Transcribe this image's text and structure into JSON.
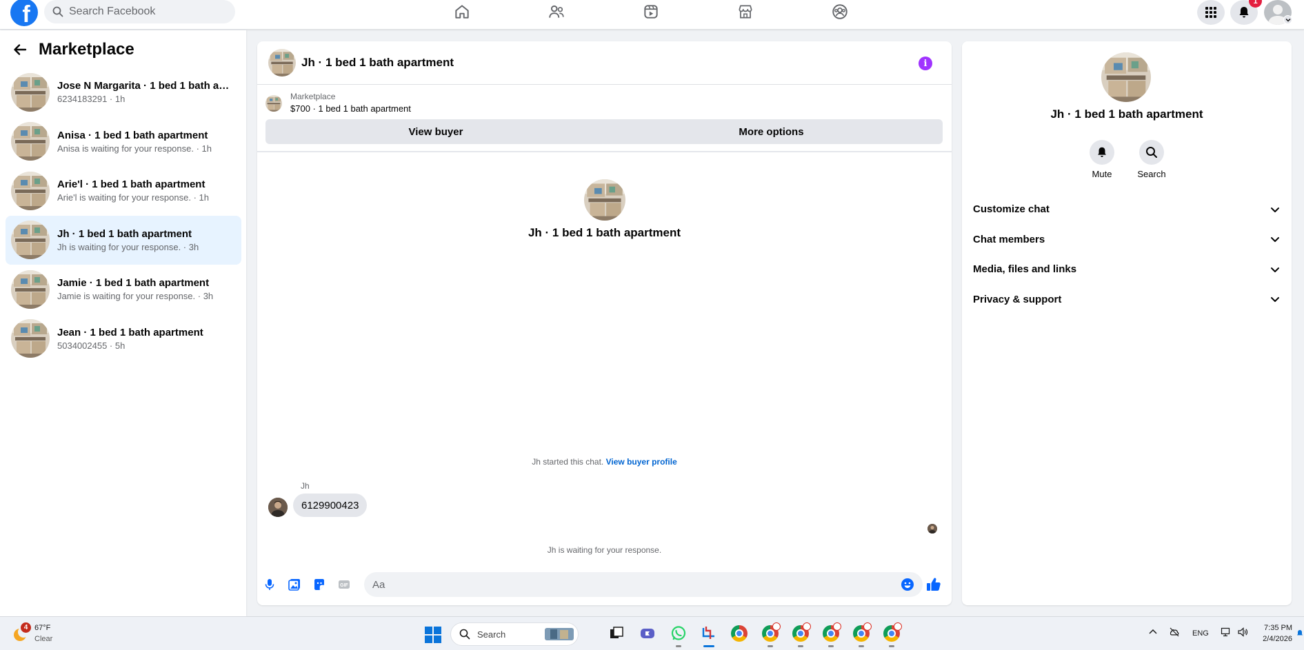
{
  "topbar": {
    "search_placeholder": "Search Facebook",
    "notification_count": "1",
    "nav_items": [
      "home-icon",
      "friends-icon",
      "video-icon",
      "marketplace-icon",
      "groups-icon"
    ]
  },
  "sidebar": {
    "title": "Marketplace",
    "conversations": [
      {
        "title": "Jose N Margarita · 1 bed 1 bath ap...",
        "subtitle": "6234183291 · 1h"
      },
      {
        "title": "Anisa · 1 bed 1 bath apartment",
        "subtitle": "Anisa is waiting for your response. · 1h"
      },
      {
        "title": "Arie'l · 1 bed 1 bath apartment",
        "subtitle": "Arie'l is waiting for your response. · 1h"
      },
      {
        "title": "Jh · 1 bed 1 bath apartment",
        "subtitle": "Jh is waiting for your response. · 3h"
      },
      {
        "title": "Jamie · 1 bed 1 bath apartment",
        "subtitle": "Jamie is waiting for your response. · 3h"
      },
      {
        "title": "Jean · 1 bed 1 bath apartment",
        "subtitle": "5034002455 · 5h"
      }
    ]
  },
  "chat": {
    "title": "Jh · 1 bed 1 bath apartment",
    "listing_source": "Marketplace",
    "listing_price_title": "$700 · 1 bed 1 bath apartment",
    "view_buyer_label": "View buyer",
    "more_options_label": "More options",
    "center_name": "Jh · 1 bed 1 bath apartment",
    "started_text": "Jh started this chat.",
    "view_buyer_profile_link": "View buyer profile",
    "sender_name": "Jh",
    "message": "6129900423",
    "waiting_text": "Jh is waiting for your response.",
    "composer_placeholder": "Aa"
  },
  "info_panel": {
    "name": "Jh · 1 bed 1 bath apartment",
    "mute_label": "Mute",
    "search_label": "Search",
    "sections": [
      "Customize chat",
      "Chat members",
      "Media, files and links",
      "Privacy & support"
    ]
  },
  "taskbar": {
    "weather_badge": "4",
    "temperature": "67°F",
    "condition": "Clear",
    "search_placeholder": "Search",
    "language": "ENG",
    "time": "7:35 PM",
    "date": "2/4/2026"
  },
  "colors": {
    "fb_blue": "#1877f2",
    "active_conv_bg": "#e7f3ff",
    "info_purple": "#a033ff",
    "link_blue": "#0064d1"
  }
}
